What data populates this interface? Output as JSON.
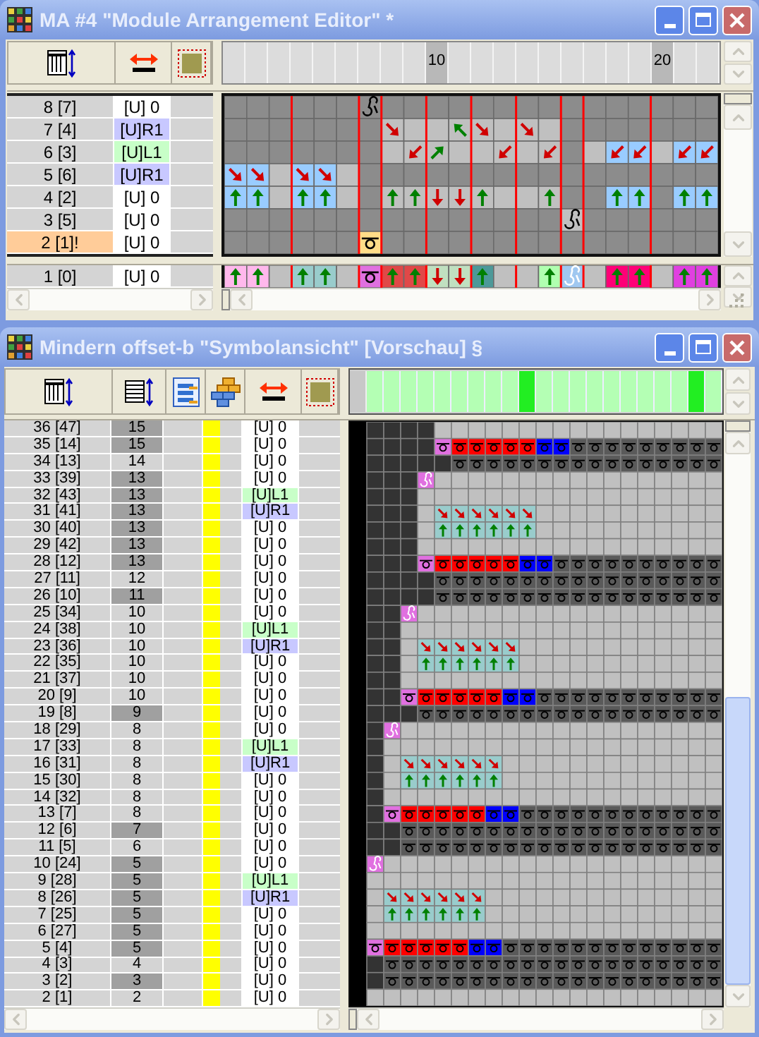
{
  "arrangement_window": {
    "title": "MA #4 \"Module Arrangement Editor\" *",
    "ruler_labels": [
      "10",
      "20"
    ],
    "modules": [
      {
        "name": "8 [7]",
        "value": "[U] 0",
        "color": "#ffffff",
        "highlighted": false
      },
      {
        "name": "7 [4]",
        "value": "[U]R1",
        "color": "#c8c8ff",
        "highlighted": false
      },
      {
        "name": "6 [3]",
        "value": "[U]L1",
        "color": "#c8ffc8",
        "highlighted": false
      },
      {
        "name": "5 [6]",
        "value": "[U]R1",
        "color": "#c8c8ff",
        "highlighted": false
      },
      {
        "name": "4 [2]",
        "value": "[U] 0",
        "color": "#ffffff",
        "highlighted": false
      },
      {
        "name": "3 [5]",
        "value": "[U] 0",
        "color": "#ffffff",
        "highlighted": false
      },
      {
        "name": "2 [1]!",
        "value": "[U] 0",
        "color": "#ffffff",
        "highlighted": true
      }
    ],
    "footer_module": {
      "name": "1 [0]",
      "value": "[U] 0",
      "color": "#ffffff",
      "highlighted": false
    }
  },
  "preview_window": {
    "title": "Mindern offset-b \"Symbolansicht\" [Vorschau] §",
    "columns": [
      {
        "selected": false
      },
      {
        "selected": false
      },
      {
        "selected": false
      },
      {
        "selected": false
      },
      {
        "selected": false
      },
      {
        "selected": false
      },
      {
        "selected": false
      },
      {
        "selected": false
      },
      {
        "selected": false
      },
      {
        "selected": true
      },
      {
        "selected": false
      },
      {
        "selected": false
      },
      {
        "selected": false
      },
      {
        "selected": false
      },
      {
        "selected": false
      },
      {
        "selected": false
      },
      {
        "selected": false
      },
      {
        "selected": false
      },
      {
        "selected": false
      },
      {
        "selected": true
      },
      {
        "selected": false
      }
    ],
    "modules": [
      {
        "name": "36 [47]",
        "count": "15",
        "shaded": true,
        "value": "[U] 0",
        "color": "#ffffff"
      },
      {
        "name": "35 [14]",
        "count": "15",
        "shaded": true,
        "value": "[U] 0",
        "color": "#ffffff"
      },
      {
        "name": "34 [13]",
        "count": "14",
        "shaded": false,
        "value": "[U] 0",
        "color": "#ffffff"
      },
      {
        "name": "33 [39]",
        "count": "13",
        "shaded": true,
        "value": "[U] 0",
        "color": "#ffffff"
      },
      {
        "name": "32 [43]",
        "count": "13",
        "shaded": true,
        "value": "[U]L1",
        "color": "#c8ffc8"
      },
      {
        "name": "31 [41]",
        "count": "13",
        "shaded": true,
        "value": "[U]R1",
        "color": "#c8c8ff"
      },
      {
        "name": "30 [40]",
        "count": "13",
        "shaded": true,
        "value": "[U] 0",
        "color": "#ffffff"
      },
      {
        "name": "29 [42]",
        "count": "13",
        "shaded": true,
        "value": "[U] 0",
        "color": "#ffffff"
      },
      {
        "name": "28 [12]",
        "count": "13",
        "shaded": true,
        "value": "[U] 0",
        "color": "#ffffff"
      },
      {
        "name": "27 [11]",
        "count": "12",
        "shaded": false,
        "value": "[U] 0",
        "color": "#ffffff"
      },
      {
        "name": "26 [10]",
        "count": "11",
        "shaded": true,
        "value": "[U] 0",
        "color": "#ffffff"
      },
      {
        "name": "25 [34]",
        "count": "10",
        "shaded": false,
        "value": "[U] 0",
        "color": "#ffffff"
      },
      {
        "name": "24 [38]",
        "count": "10",
        "shaded": false,
        "value": "[U]L1",
        "color": "#c8ffc8"
      },
      {
        "name": "23 [36]",
        "count": "10",
        "shaded": false,
        "value": "[U]R1",
        "color": "#c8c8ff"
      },
      {
        "name": "22 [35]",
        "count": "10",
        "shaded": false,
        "value": "[U] 0",
        "color": "#ffffff"
      },
      {
        "name": "21 [37]",
        "count": "10",
        "shaded": false,
        "value": "[U] 0",
        "color": "#ffffff"
      },
      {
        "name": "20 [9]",
        "count": "10",
        "shaded": false,
        "value": "[U] 0",
        "color": "#ffffff"
      },
      {
        "name": "19 [8]",
        "count": "9",
        "shaded": true,
        "value": "[U] 0",
        "color": "#ffffff"
      },
      {
        "name": "18 [29]",
        "count": "8",
        "shaded": false,
        "value": "[U] 0",
        "color": "#ffffff"
      },
      {
        "name": "17 [33]",
        "count": "8",
        "shaded": false,
        "value": "[U]L1",
        "color": "#c8ffc8"
      },
      {
        "name": "16 [31]",
        "count": "8",
        "shaded": false,
        "value": "[U]R1",
        "color": "#c8c8ff"
      },
      {
        "name": "15 [30]",
        "count": "8",
        "shaded": false,
        "value": "[U] 0",
        "color": "#ffffff"
      },
      {
        "name": "14 [32]",
        "count": "8",
        "shaded": false,
        "value": "[U] 0",
        "color": "#ffffff"
      },
      {
        "name": "13 [7]",
        "count": "8",
        "shaded": false,
        "value": "[U] 0",
        "color": "#ffffff"
      },
      {
        "name": "12 [6]",
        "count": "7",
        "shaded": true,
        "value": "[U] 0",
        "color": "#ffffff"
      },
      {
        "name": "11 [5]",
        "count": "6",
        "shaded": false,
        "value": "[U] 0",
        "color": "#ffffff"
      },
      {
        "name": "10 [24]",
        "count": "5",
        "shaded": true,
        "value": "[U] 0",
        "color": "#ffffff"
      },
      {
        "name": "9 [28]",
        "count": "5",
        "shaded": true,
        "value": "[U]L1",
        "color": "#c8ffc8"
      },
      {
        "name": "8 [26]",
        "count": "5",
        "shaded": true,
        "value": "[U]R1",
        "color": "#c8c8ff"
      },
      {
        "name": "7 [25]",
        "count": "5",
        "shaded": true,
        "value": "[U] 0",
        "color": "#ffffff"
      },
      {
        "name": "6 [27]",
        "count": "5",
        "shaded": true,
        "value": "[U] 0",
        "color": "#ffffff"
      },
      {
        "name": "5 [4]",
        "count": "5",
        "shaded": true,
        "value": "[U] 0",
        "color": "#ffffff"
      },
      {
        "name": "4 [3]",
        "count": "4",
        "shaded": false,
        "value": "[U] 0",
        "color": "#ffffff"
      },
      {
        "name": "3 [2]",
        "count": "3",
        "shaded": true,
        "value": "[U] 0",
        "color": "#ffffff"
      },
      {
        "name": "2 [1]",
        "count": "2",
        "shaded": false,
        "value": "[U] 0",
        "color": "#ffffff"
      }
    ]
  }
}
